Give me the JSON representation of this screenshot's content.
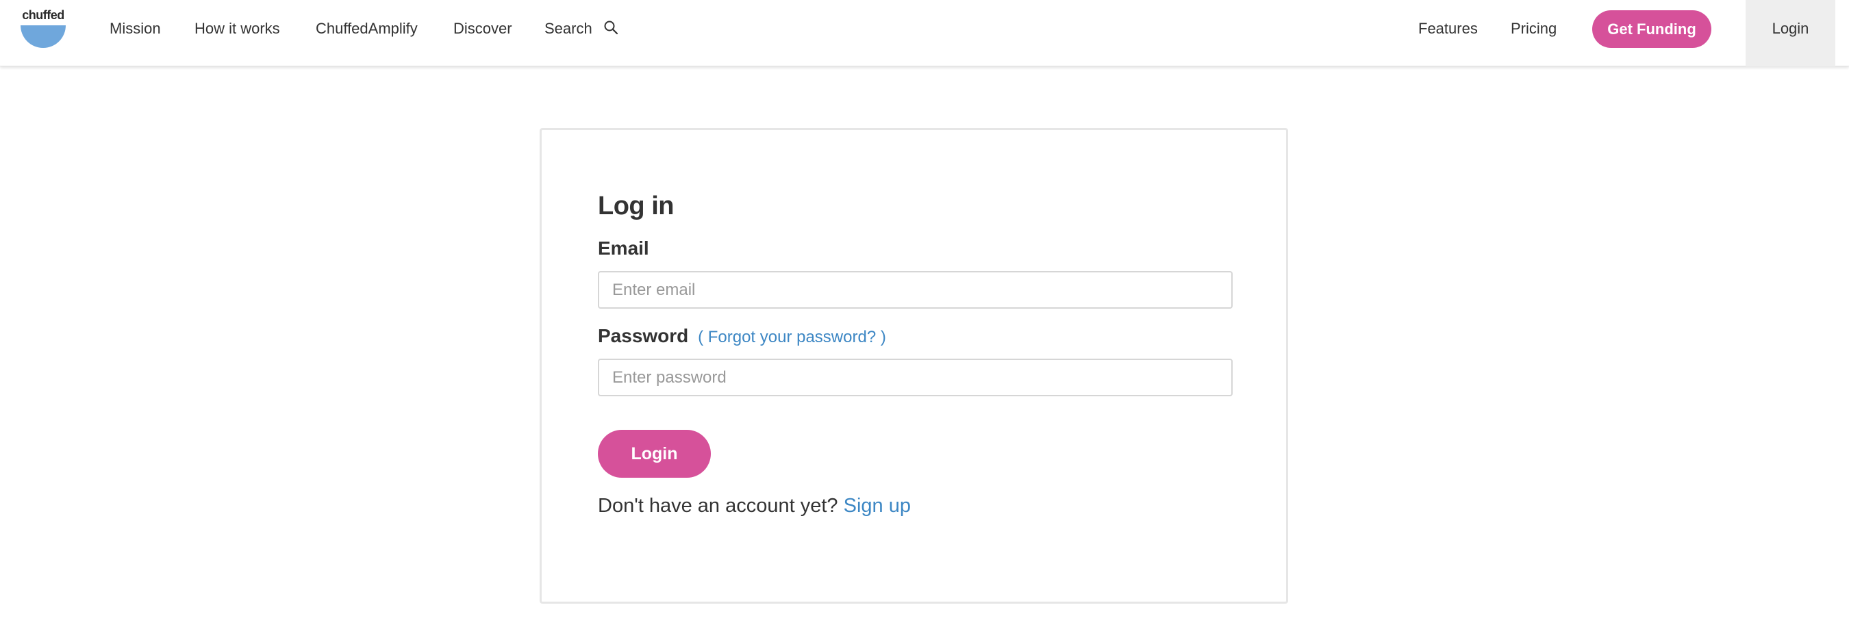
{
  "brand": {
    "logo_text": "chuffed",
    "accent_color": "#d6519a",
    "logo_color": "#6fa7dc",
    "link_color": "#3d87c4"
  },
  "nav": {
    "mission": "Mission",
    "how_it_works": "How it works",
    "amplify": "ChuffedAmplify",
    "discover": "Discover",
    "search": "Search",
    "search_icon": "search-icon",
    "features": "Features",
    "pricing": "Pricing",
    "get_funding": "Get Funding",
    "login": "Login"
  },
  "login_form": {
    "title": "Log in",
    "email_label": "Email",
    "email_placeholder": "Enter email",
    "email_value": "",
    "password_label": "Password",
    "forgot_password": "( Forgot your password? )",
    "password_placeholder": "Enter password",
    "password_value": "",
    "submit_label": "Login",
    "no_account_text": "Don't have an account yet?",
    "signup_link": "Sign up"
  }
}
